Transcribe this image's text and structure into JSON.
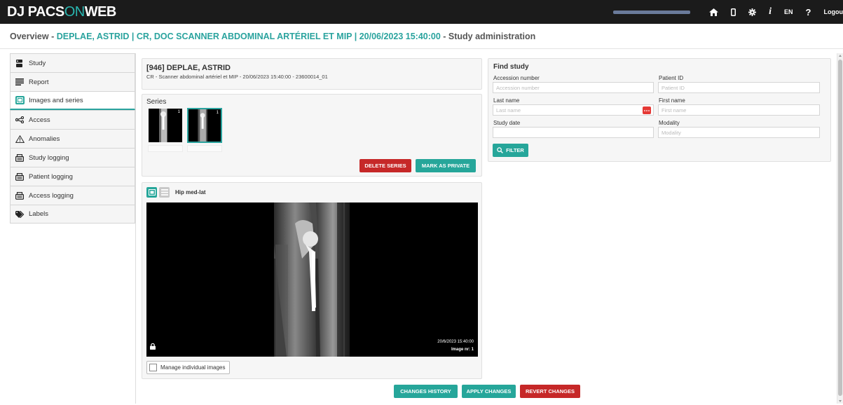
{
  "app": {
    "logo_left": "DJ PACS",
    "logo_on": "ON",
    "logo_right": "WEB"
  },
  "topnav": {
    "language": "EN",
    "help": "?",
    "logout": "Logou",
    "info": "i",
    "icons": [
      "home-icon",
      "mobile-icon",
      "gear-icon",
      "info-icon"
    ]
  },
  "title": {
    "prefix": "Overview - ",
    "highlight": "DEPLAE, ASTRID | CR, DOC SCANNER ABDOMINAL ARTÉRIEL ET MIP | 20/06/2023 15:40:00",
    "suffix": " - Study administration"
  },
  "sidebar": {
    "items": [
      {
        "label": "Study",
        "icon": "study-icon",
        "active": false
      },
      {
        "label": "Report",
        "icon": "report-icon",
        "active": false
      },
      {
        "label": "Images and series",
        "icon": "images-icon",
        "active": true
      },
      {
        "label": "Access",
        "icon": "share-icon",
        "active": false
      },
      {
        "label": "Anomalies",
        "icon": "warning-icon",
        "active": false
      },
      {
        "label": "Study logging",
        "icon": "log-icon",
        "active": false
      },
      {
        "label": "Patient logging",
        "icon": "log-icon",
        "active": false
      },
      {
        "label": "Access logging",
        "icon": "log-icon",
        "active": false
      },
      {
        "label": "Labels",
        "icon": "tag-icon",
        "active": false
      }
    ]
  },
  "patient": {
    "name": "[946] DEPLAE, ASTRID",
    "description": "CR - Scanner abdominal artériel et MIP - 20/06/2023 15:40:00 - 23600014_01"
  },
  "series": {
    "title": "Series",
    "thumbnails": [
      {
        "number": "1"
      },
      {
        "number": "1"
      }
    ],
    "delete_label": "DELETE SERIES",
    "private_label": "MARK AS PRIVATE"
  },
  "viewer": {
    "title": "Hip med-lat",
    "datetime": "20/6/2023 15:40:00",
    "image_number": "Image nr: 1",
    "manage_label": "Manage individual images"
  },
  "find_study": {
    "title": "Find study",
    "accession_label": "Accession number",
    "accession_placeholder": "Accession number",
    "patient_id_label": "Patient ID",
    "patient_id_placeholder": "Patient ID",
    "last_name_label": "Last name",
    "last_name_placeholder": "Last name",
    "first_name_label": "First name",
    "first_name_placeholder": "First name",
    "study_date_label": "Study date",
    "modality_label": "Modality",
    "modality_placeholder": "Modality",
    "filter_label": "FILTER"
  },
  "footer_buttons": {
    "history": "CHANGES HISTORY",
    "apply": "APPLY CHANGES",
    "revert": "REVERT CHANGES"
  },
  "colors": {
    "accent": "#2aa39e",
    "danger": "#c62828",
    "topbar": "#1b1b1b"
  }
}
